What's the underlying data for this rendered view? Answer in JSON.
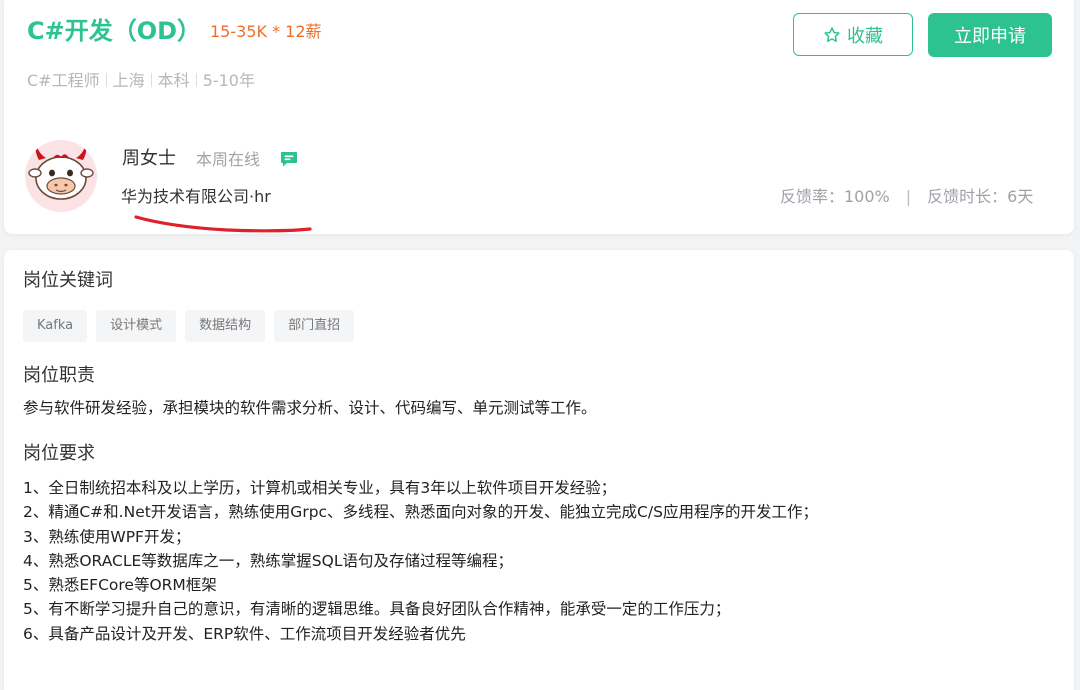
{
  "job": {
    "title": "C#开发（OD）",
    "salary": "15-35K * 12薪",
    "tags": [
      "C#工程师",
      "上海",
      "本科",
      "5-10年"
    ]
  },
  "actions": {
    "collect_label": "收藏",
    "apply_label": "立即申请"
  },
  "recruiter": {
    "name": "周女士",
    "online_status": "本周在线",
    "company_role": "华为技术有限公司·hr",
    "feedback_rate": "反馈率：100%",
    "feedback_separator": "|",
    "feedback_time": "反馈时长：6天"
  },
  "sections": {
    "keywords_title": "岗位关键词",
    "keywords": [
      "Kafka",
      "设计模式",
      "数据结构",
      "部门直招"
    ],
    "duty_title": "岗位职责",
    "duty_text": "参与软件研发经验，承担模块的软件需求分析、设计、代码编写、单元测试等工作。",
    "requirements_title": "岗位要求",
    "requirements": [
      "1、全日制统招本科及以上学历，计算机或相关专业，具有3年以上软件项目开发经验；",
      "2、精通C#和.Net开发语言，熟练使用Grpc、多线程、熟悉面向对象的开发、能独立完成C/S应用程序的开发工作；",
      "3、熟练使用WPF开发；",
      "4、熟悉ORACLE等数据库之一，熟练掌握SQL语句及存储过程等编程；",
      "5、熟悉EFCore等ORM框架",
      "5、有不断学习提升自己的意识，有清晰的逻辑思维。具备良好团队合作精神，能承受一定的工作压力；",
      "6、具备产品设计及开发、ERP软件、工作流项目开发经验者优先"
    ]
  },
  "colors": {
    "accent": "#2dc391",
    "salary": "#f26d2a",
    "annotation_underline": "#e0202a"
  },
  "icons": {
    "collect": "star-outline-icon",
    "chat": "chat-bubble-icon",
    "avatar": "cow-avatar-icon"
  }
}
